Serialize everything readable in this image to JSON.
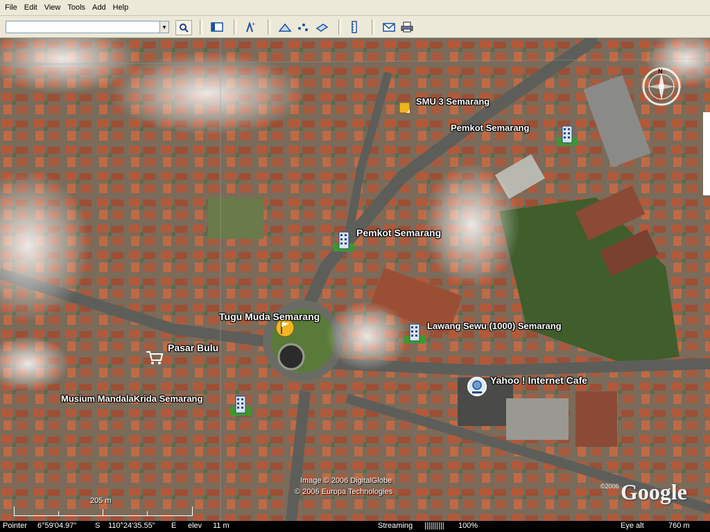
{
  "menu": [
    "File",
    "Edit",
    "View",
    "Tools",
    "Add",
    "Help"
  ],
  "toolbar": {
    "search_value": ""
  },
  "places": [
    {
      "label": "SMU 3 Semarang"
    },
    {
      "label": "Pemkot Semarang"
    },
    {
      "label": "Pemkot Semarang"
    },
    {
      "label": "Tugu Muda Semarang"
    },
    {
      "label": "Lawang Sewu (1000) Semarang"
    },
    {
      "label": "Pasar Bulu"
    },
    {
      "label": "Yahoo ! Internet Cafe"
    },
    {
      "label": "Musium MandalaKrida Semarang"
    }
  ],
  "credits": {
    "line1": "Image © 2006 DigitalGlobe",
    "line2": "© 2006 Europa Technologies",
    "year": "©2006",
    "logo": "Google"
  },
  "compass": {
    "north": "N"
  },
  "scale": {
    "label": "205 m"
  },
  "status": {
    "pointer_label": "Pointer",
    "latitude": "6°59'04.97\"",
    "lat_dir": "S",
    "longitude": "110°24'35.55\"",
    "lon_dir": "E",
    "elev_label": "elev",
    "elev_value": "11 m",
    "streaming_label": "Streaming",
    "streaming_bar": "||||||||||",
    "streaming_pct": "100%",
    "eye_alt_label": "Eye alt",
    "eye_alt_value": "760 m"
  }
}
